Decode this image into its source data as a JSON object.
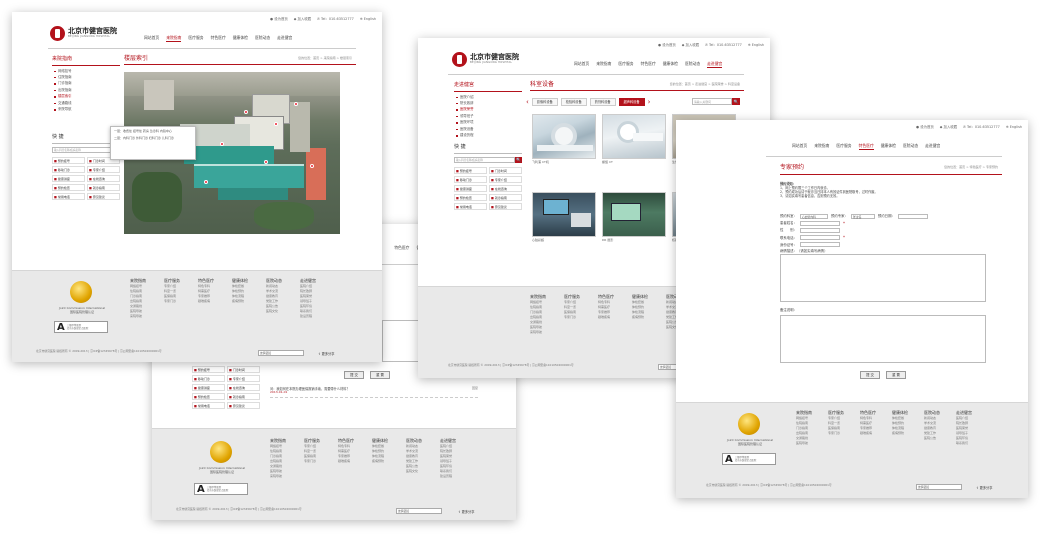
{
  "colors": {
    "accent": "#b3121b",
    "footer_bg": "#e9e9e9"
  },
  "common": {
    "hospital_name": "北京市健宫医院",
    "hospital_name_en": "BEIJING JIANGONG HOSPITAL",
    "topbar": [
      "● 设为首页",
      "◆ 加入收藏",
      "✆ Tel：010-63512777",
      "⊕ English"
    ],
    "nav": [
      "网站首页",
      "来院指南",
      "医疗服务",
      "特色医疗",
      "健康体检",
      "医院动态",
      "走进健宫"
    ],
    "quick_title": "快 捷",
    "search_placeholder": "输入科室名称/疾病名称",
    "search_button": "🔍",
    "quick_links": [
      "预约挂号",
      "门诊时间",
      "移动门诊",
      "专家介绍",
      "健康讲座",
      "在线咨询",
      "预约检查",
      "就诊指南",
      "常用电话",
      "意见建议"
    ],
    "footer_cols": [
      {
        "title": "来院指南",
        "items": [
          "网络挂号",
          "住院指南",
          "门诊指南",
          "出院指南",
          "交通路线",
          "医院导航",
          "来院导航"
        ]
      },
      {
        "title": "医疗服务",
        "items": [
          "专家介绍",
          "科室一览",
          "医保指南",
          "专家门诊"
        ]
      },
      {
        "title": "特色医疗",
        "items": [
          "特色专科",
          "特需医疗",
          "专家推荐",
          "疑难疾病"
        ]
      },
      {
        "title": "健康体检",
        "items": [
          "体检套餐",
          "体检预约",
          "体检流程",
          "疾病预防"
        ]
      },
      {
        "title": "医院动态",
        "items": [
          "新闻动态",
          "学术交流",
          "健康教育",
          "党建工作",
          "医院公告",
          "医院文化"
        ]
      },
      {
        "title": "走进健宫",
        "items": [
          "医院介绍",
          "院长致辞",
          "医院荣誉",
          "领导班子",
          "医院环境",
          "联系我们",
          "建设历程"
        ]
      }
    ],
    "jci": "Joint Commission International",
    "jci_cn": "国际医院管理认证",
    "a_cert": [
      "三级甲等医院",
      "北京市医保定点医院"
    ],
    "copyright": "北京市健宫医院 版权所有 © 2009-2013 | 京ICP备12345678号 | 京公网安备11010502000001号",
    "link_select": "友情链接",
    "share": "⇪ 更多分享"
  },
  "shot1": {
    "side_title": "来院指南",
    "side_items": [
      "网络挂号",
      "住院指南",
      "门诊指南",
      "出院指南",
      "楼层索引",
      "交通路线",
      "来院导航"
    ],
    "side_active": 4,
    "content_title": "楼层索引",
    "crumb": "您的位置：首页 > 来院指南 > 楼层索引",
    "popup_line1": "一层：收费处 挂号处 药房 急诊科 内镜中心",
    "popup_line2": "二层：内科门诊 外科门诊 妇科门诊 儿科门诊"
  },
  "shot2": {
    "side_title": "走进健宫",
    "side_items": [
      "医院介绍",
      "院长致辞",
      "医院荣誉",
      "领导班子",
      "医院环境",
      "医院设备",
      "建设历程"
    ],
    "side_active": 2,
    "content_title": "科室设备",
    "crumb": "您的位置：首页 > 走进健宫 > 医院荣誉 > 科室设备",
    "tabs": [
      "影像科设备",
      "检验科设备",
      "药剂科设备",
      "超声科设备"
    ],
    "tab_active": 3,
    "search_placeholder": "请输入关键词",
    "equipment": [
      {
        "caption": "飞利浦 CT机"
      },
      {
        "caption": "螺旋 CT"
      },
      {
        "caption": "生化仪"
      },
      {
        "caption": "心脏彩超"
      },
      {
        "caption": "DR 摄影"
      },
      {
        "caption": "核磁共振"
      }
    ]
  },
  "shot3": {
    "breadcrumb": "您的位置：首页 > 医院动态 > 在线咨询",
    "submit": "提 交",
    "reset": "重 置",
    "msg_title": "问：我如何在本院办理医保报销手续，需要带什么材料？",
    "msg_date": "2013-01-01",
    "msg_reply": "回复",
    "msg_answer": "答：您好，请携带身份证及医保卡前往收费处办理。"
  },
  "shot4": {
    "content_title": "专家预约",
    "crumb": "您的位置：首页 > 特色医疗 > 专家预约",
    "notice_title": "预约须知：",
    "notice": [
      "网上预约限三个工作日内就诊。",
      "预约成功后请于就诊当日持本人有效证件到医院取号，过时作废。",
      "请如实填写患者信息，否则预约无效。"
    ],
    "labels": {
      "dept": "预约科室：",
      "doctor": "预约专家：",
      "date": "预约日期：",
      "name": "患者姓名：",
      "sex": "性　　别：",
      "phone": "联系电话：",
      "idcard": "身份证号：",
      "illness": "病情描述：（请如实填写病情）",
      "remark": "备注说明："
    },
    "dept_value": "心血管内科",
    "doctor_value": "张主任",
    "submit": "提 交",
    "reset": "重 置"
  }
}
